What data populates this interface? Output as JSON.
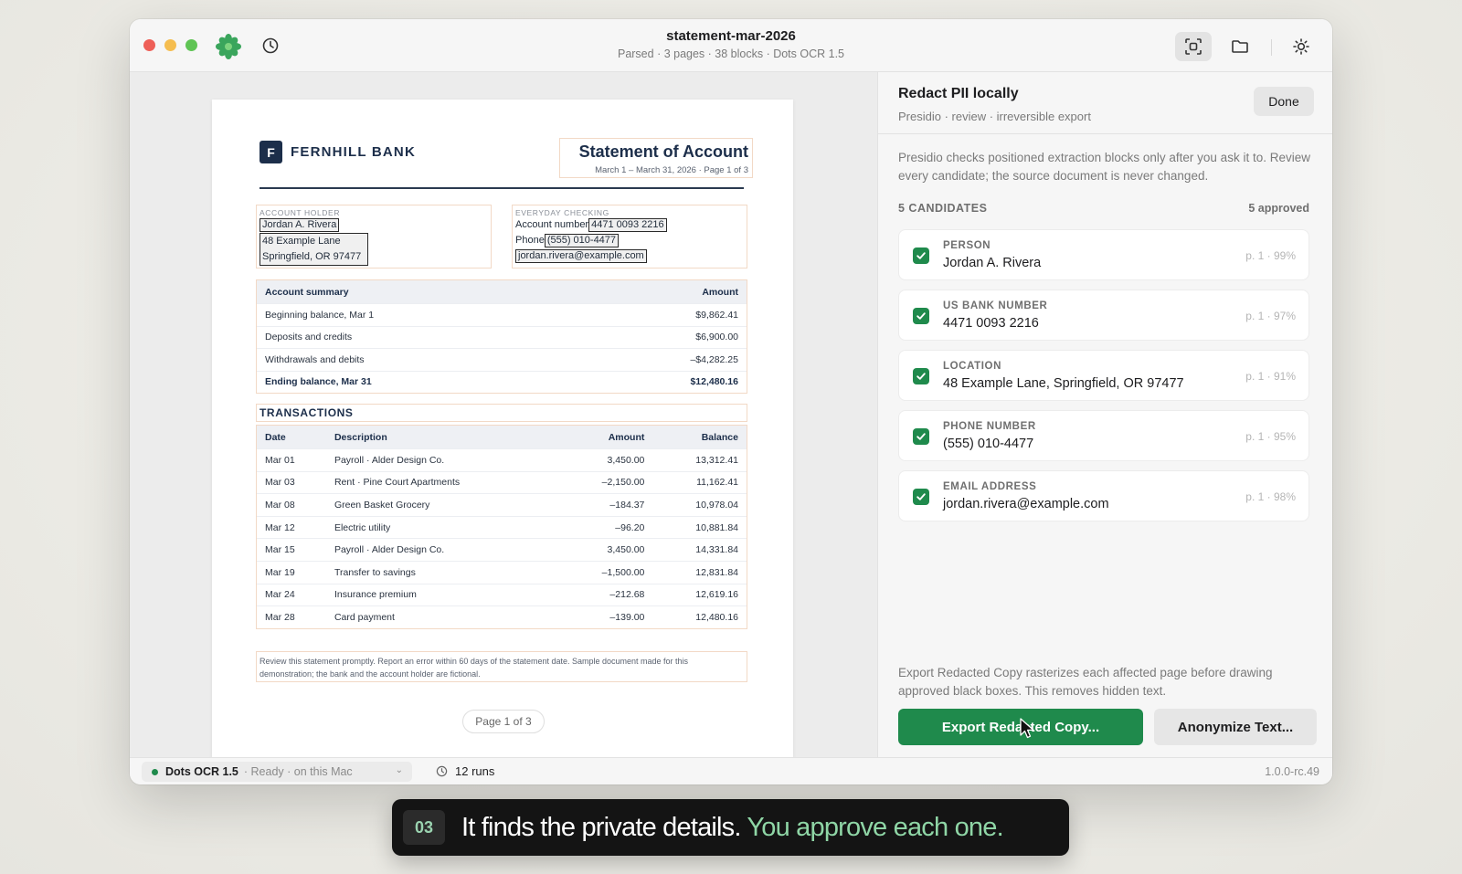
{
  "window": {
    "title": "statement-mar-2026",
    "subtitle": "Parsed · 3 pages · 38 blocks · Dots OCR 1.5"
  },
  "document": {
    "bank_logo_letter": "F",
    "bank_name": "FERNHILL BANK",
    "statement_title": "Statement of Account",
    "statement_sub": "March 1 – March 31, 2026 · Page 1 of 3",
    "account_holder": {
      "label": "ACCOUNT HOLDER",
      "name": "Jordan A. Rivera",
      "address_line1": "48 Example Lane",
      "address_line2": "Springfield, OR 97477"
    },
    "checking": {
      "label": "EVERYDAY CHECKING",
      "account_label": "Account number",
      "account_number": "4471 0093 2216",
      "phone_label": "Phone",
      "phone": "(555) 010-4477",
      "email": "jordan.rivera@example.com"
    },
    "summary": {
      "header": [
        "Account summary",
        "Amount"
      ],
      "rows": [
        {
          "label": "Beginning balance, Mar 1",
          "amount": "$9,862.41"
        },
        {
          "label": "Deposits and credits",
          "amount": "$6,900.00"
        },
        {
          "label": "Withdrawals and debits",
          "amount": "–$4,282.25"
        },
        {
          "label": "Ending balance, Mar 31",
          "amount": "$12,480.16"
        }
      ]
    },
    "transactions": {
      "title": "TRANSACTIONS",
      "header": [
        "Date",
        "Description",
        "Amount",
        "Balance"
      ],
      "rows": [
        {
          "date": "Mar 01",
          "desc": "Payroll · Alder Design Co.",
          "amount": "3,450.00",
          "balance": "13,312.41"
        },
        {
          "date": "Mar 03",
          "desc": "Rent · Pine Court Apartments",
          "amount": "–2,150.00",
          "balance": "11,162.41"
        },
        {
          "date": "Mar 08",
          "desc": "Green Basket Grocery",
          "amount": "–184.37",
          "balance": "10,978.04"
        },
        {
          "date": "Mar 12",
          "desc": "Electric utility",
          "amount": "–96.20",
          "balance": "10,881.84"
        },
        {
          "date": "Mar 15",
          "desc": "Payroll · Alder Design Co.",
          "amount": "3,450.00",
          "balance": "14,331.84"
        },
        {
          "date": "Mar 19",
          "desc": "Transfer to savings",
          "amount": "–1,500.00",
          "balance": "12,831.84"
        },
        {
          "date": "Mar 24",
          "desc": "Insurance premium",
          "amount": "–212.68",
          "balance": "12,619.16"
        },
        {
          "date": "Mar 28",
          "desc": "Card payment",
          "amount": "–139.00",
          "balance": "12,480.16"
        }
      ]
    },
    "footnote": "Review this statement promptly. Report an error within 60 days of the statement date. Sample document made for this demonstration; the bank and the account holder are fictional.",
    "page_indicator": "Page 1 of 3"
  },
  "panel": {
    "title": "Redact PII locally",
    "subtitle": "Presidio · review · irreversible export",
    "done_label": "Done",
    "description": "Presidio checks positioned extraction blocks only after you ask it to. Review every candidate; the source document is never changed.",
    "candidates_label": "5 CANDIDATES",
    "approved_label": "5 approved",
    "candidates": [
      {
        "type": "PERSON",
        "value": "Jordan A. Rivera",
        "meta": "p. 1 · 99%",
        "approved": true
      },
      {
        "type": "US BANK NUMBER",
        "value": "4471 0093 2216",
        "meta": "p. 1 · 97%",
        "approved": true
      },
      {
        "type": "LOCATION",
        "value": "48 Example Lane, Springfield, OR 97477",
        "meta": "p. 1 · 91%",
        "approved": true
      },
      {
        "type": "PHONE NUMBER",
        "value": "(555) 010-4477",
        "meta": "p. 1 · 95%",
        "approved": true
      },
      {
        "type": "EMAIL ADDRESS",
        "value": "jordan.rivera@example.com",
        "meta": "p. 1 · 98%",
        "approved": true
      }
    ],
    "export_description": "Export Redacted Copy rasterizes each affected page before drawing approved black boxes. This removes hidden text.",
    "export_button": "Export Redacted Copy...",
    "anonymize_button": "Anonymize Text..."
  },
  "statusbar": {
    "engine_name": "Dots OCR 1.5",
    "engine_status": "· Ready · on this Mac",
    "runs": "12 runs",
    "version": "1.0.0-rc.49"
  },
  "caption": {
    "step": "03",
    "text": "It finds the private details.",
    "accent": "You approve each one."
  },
  "colors": {
    "accent_green": "#1f8a4c",
    "caption_accent": "#8fd6a6",
    "bank_navy": "#1c2e4a"
  },
  "icons": {
    "app_logo": "green-flower-icon",
    "history": "clock-icon",
    "scan": "scan-viewfinder-icon",
    "folder": "folder-icon",
    "theme": "sun-icon",
    "checkbox": "checkmark-icon",
    "runs": "clock-icon",
    "engine_select": "chevron-down-icon"
  }
}
